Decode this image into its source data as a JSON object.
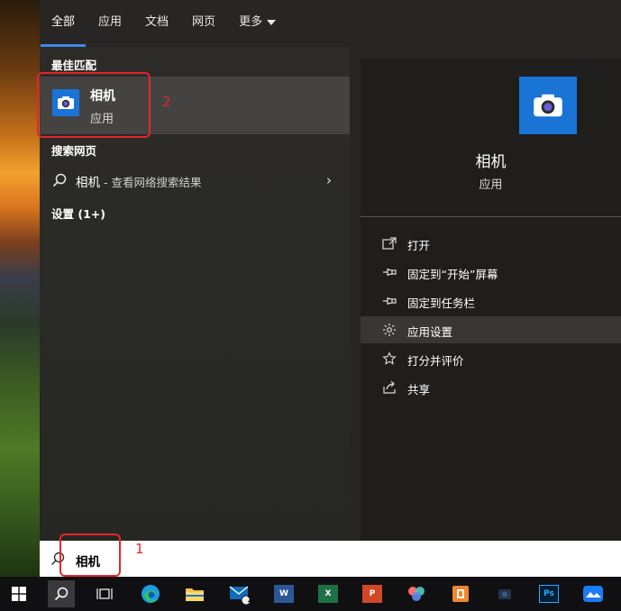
{
  "tabs": [
    {
      "label": "全部",
      "active": true
    },
    {
      "label": "应用",
      "active": false
    },
    {
      "label": "文档",
      "active": false
    },
    {
      "label": "网页",
      "active": false
    },
    {
      "label": "更多",
      "active": false,
      "has_dropdown": true
    }
  ],
  "left": {
    "best_match_header": "最佳匹配",
    "best_match": {
      "title": "相机",
      "subtitle": "应用",
      "icon": "camera-icon"
    },
    "web_header": "搜索网页",
    "web_result": {
      "query": "相机",
      "suffix": " - 查看网络搜索结果",
      "icon": "search-icon"
    },
    "settings_header": "设置 (1+)"
  },
  "annotations": {
    "label_1": "1",
    "label_2": "2",
    "color": "#e5262a"
  },
  "right": {
    "title": "相机",
    "subtitle": "应用",
    "actions": [
      {
        "label": "打开",
        "icon": "open-icon"
      },
      {
        "label": "固定到“开始”屏幕",
        "icon": "pin-icon"
      },
      {
        "label": "固定到任务栏",
        "icon": "pin-icon"
      },
      {
        "label": "应用设置",
        "icon": "gear-icon",
        "highlighted": true
      },
      {
        "label": "打分并评价",
        "icon": "star-icon"
      },
      {
        "label": "共享",
        "icon": "share-icon"
      }
    ]
  },
  "search": {
    "value": "相机"
  },
  "taskbar": {
    "items": [
      "windows-start-icon",
      "search-icon",
      "task-view-icon",
      "edge-icon",
      "file-explorer-icon",
      "mail-icon",
      "word-icon",
      "excel-icon",
      "powerpoint-icon",
      "app-icon",
      "office-app-icon",
      "camera-app-icon",
      "photoshop-icon",
      "cloud-app-icon"
    ],
    "mail_badge": "1",
    "word_label": "W",
    "excel_label": "X",
    "ppt_label": "P",
    "ps_label": "Ps"
  },
  "colors": {
    "accent": "#3f88e6",
    "app_tile": "#1a74d6",
    "annotation_red": "#e5262a"
  }
}
